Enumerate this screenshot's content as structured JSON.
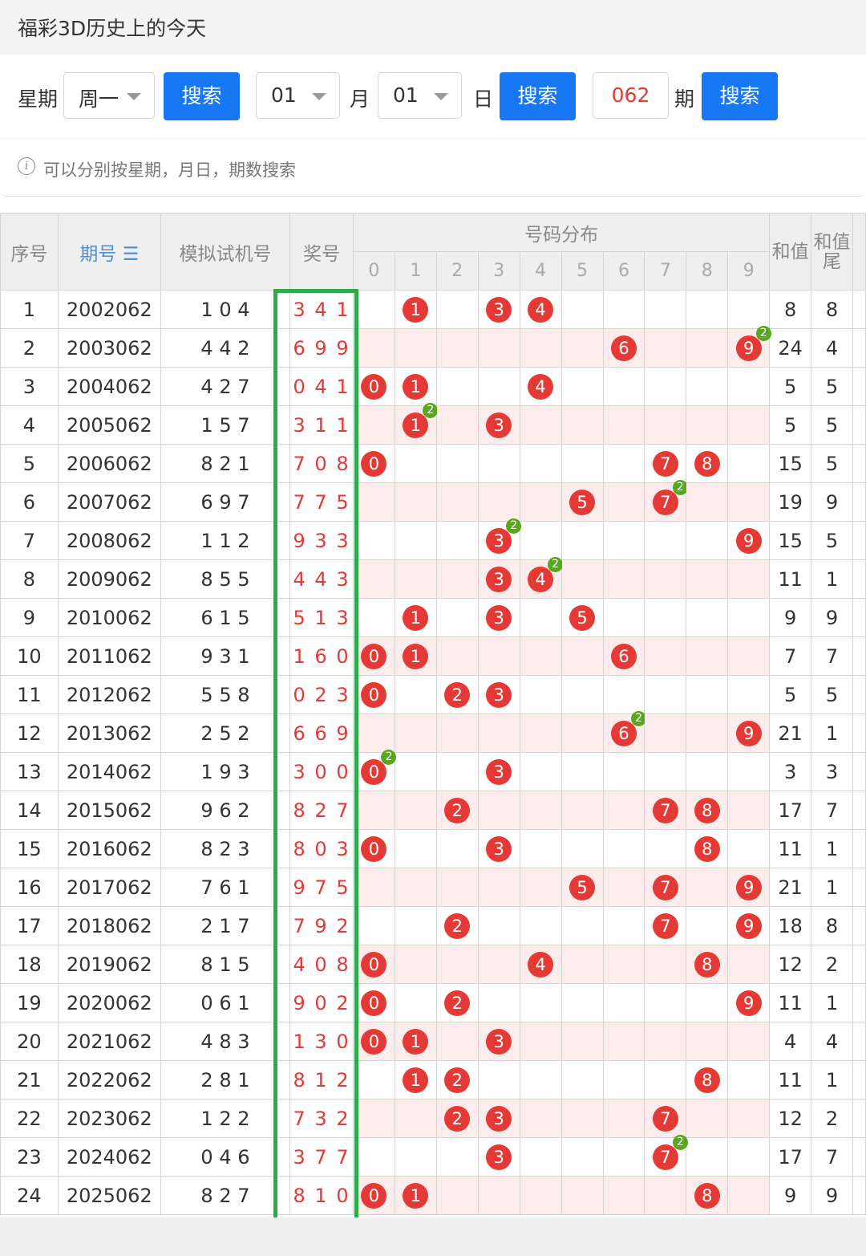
{
  "panel": {
    "title": "福彩3D历史上的今天"
  },
  "search": {
    "week_label": "星期",
    "week_value": "周一",
    "search_label": "搜索",
    "month_value": "01",
    "month_label": "月",
    "day_value": "01",
    "day_label": "日",
    "period_value": "062",
    "period_label": "期"
  },
  "hint": {
    "icon": "i",
    "text": "可以分别按星期，月日，期数搜索"
  },
  "table": {
    "headers": {
      "idx": "序号",
      "period": "期号",
      "sort_icon": "☰",
      "sim": "模拟试机号",
      "prize": "奖号",
      "dist": "号码分布",
      "sum": "和值",
      "tail": "和值尾"
    },
    "digits": [
      "0",
      "1",
      "2",
      "3",
      "4",
      "5",
      "6",
      "7",
      "8",
      "9"
    ],
    "rows": [
      {
        "idx": "1",
        "period": "2002062",
        "sim": "1 0 4",
        "prize": "3 4 1",
        "balls": [
          1,
          3,
          4
        ],
        "rep": null,
        "sum": "8",
        "tail": "8"
      },
      {
        "idx": "2",
        "period": "2003062",
        "sim": "4 4 2",
        "prize": "6 9 9",
        "balls": [
          6,
          9
        ],
        "rep": 9,
        "sum": "24",
        "tail": "4"
      },
      {
        "idx": "3",
        "period": "2004062",
        "sim": "4 2 7",
        "prize": "0 4 1",
        "balls": [
          0,
          1,
          4
        ],
        "rep": null,
        "sum": "5",
        "tail": "5"
      },
      {
        "idx": "4",
        "period": "2005062",
        "sim": "1 5 7",
        "prize": "3 1 1",
        "balls": [
          1,
          3
        ],
        "rep": 1,
        "sum": "5",
        "tail": "5"
      },
      {
        "idx": "5",
        "period": "2006062",
        "sim": "8 2 1",
        "prize": "7 0 8",
        "balls": [
          0,
          7,
          8
        ],
        "rep": null,
        "sum": "15",
        "tail": "5"
      },
      {
        "idx": "6",
        "period": "2007062",
        "sim": "6 9 7",
        "prize": "7 7 5",
        "balls": [
          5,
          7
        ],
        "rep": 7,
        "sum": "19",
        "tail": "9"
      },
      {
        "idx": "7",
        "period": "2008062",
        "sim": "1 1 2",
        "prize": "9 3 3",
        "balls": [
          3,
          9
        ],
        "rep": 3,
        "sum": "15",
        "tail": "5"
      },
      {
        "idx": "8",
        "period": "2009062",
        "sim": "8 5 5",
        "prize": "4 4 3",
        "balls": [
          3,
          4
        ],
        "rep": 4,
        "sum": "11",
        "tail": "1"
      },
      {
        "idx": "9",
        "period": "2010062",
        "sim": "6 1 5",
        "prize": "5 1 3",
        "balls": [
          1,
          3,
          5
        ],
        "rep": null,
        "sum": "9",
        "tail": "9"
      },
      {
        "idx": "10",
        "period": "2011062",
        "sim": "9 3 1",
        "prize": "1 6 0",
        "balls": [
          0,
          1,
          6
        ],
        "rep": null,
        "sum": "7",
        "tail": "7"
      },
      {
        "idx": "11",
        "period": "2012062",
        "sim": "5 5 8",
        "prize": "0 2 3",
        "balls": [
          0,
          2,
          3
        ],
        "rep": null,
        "sum": "5",
        "tail": "5"
      },
      {
        "idx": "12",
        "period": "2013062",
        "sim": "2 5 2",
        "prize": "6 6 9",
        "balls": [
          6,
          9
        ],
        "rep": 6,
        "sum": "21",
        "tail": "1"
      },
      {
        "idx": "13",
        "period": "2014062",
        "sim": "1 9 3",
        "prize": "3 0 0",
        "balls": [
          0,
          3
        ],
        "rep": 0,
        "sum": "3",
        "tail": "3"
      },
      {
        "idx": "14",
        "period": "2015062",
        "sim": "9 6 2",
        "prize": "8 2 7",
        "balls": [
          2,
          7,
          8
        ],
        "rep": null,
        "sum": "17",
        "tail": "7"
      },
      {
        "idx": "15",
        "period": "2016062",
        "sim": "8 2 3",
        "prize": "8 0 3",
        "balls": [
          0,
          3,
          8
        ],
        "rep": null,
        "sum": "11",
        "tail": "1"
      },
      {
        "idx": "16",
        "period": "2017062",
        "sim": "7 6 1",
        "prize": "9 7 5",
        "balls": [
          5,
          7,
          9
        ],
        "rep": null,
        "sum": "21",
        "tail": "1"
      },
      {
        "idx": "17",
        "period": "2018062",
        "sim": "2 1 7",
        "prize": "7 9 2",
        "balls": [
          2,
          7,
          9
        ],
        "rep": null,
        "sum": "18",
        "tail": "8"
      },
      {
        "idx": "18",
        "period": "2019062",
        "sim": "8 1 5",
        "prize": "4 0 8",
        "balls": [
          0,
          4,
          8
        ],
        "rep": null,
        "sum": "12",
        "tail": "2"
      },
      {
        "idx": "19",
        "period": "2020062",
        "sim": "0 6 1",
        "prize": "9 0 2",
        "balls": [
          0,
          2,
          9
        ],
        "rep": null,
        "sum": "11",
        "tail": "1"
      },
      {
        "idx": "20",
        "period": "2021062",
        "sim": "4 8 3",
        "prize": "1 3 0",
        "balls": [
          0,
          1,
          3
        ],
        "rep": null,
        "sum": "4",
        "tail": "4"
      },
      {
        "idx": "21",
        "period": "2022062",
        "sim": "2 8 1",
        "prize": "8 1 2",
        "balls": [
          1,
          2,
          8
        ],
        "rep": null,
        "sum": "11",
        "tail": "1"
      },
      {
        "idx": "22",
        "period": "2023062",
        "sim": "1 2 2",
        "prize": "7 3 2",
        "balls": [
          2,
          3,
          7
        ],
        "rep": null,
        "sum": "12",
        "tail": "2"
      },
      {
        "idx": "23",
        "period": "2024062",
        "sim": "0 4 6",
        "prize": "3 7 7",
        "balls": [
          3,
          7
        ],
        "rep": 7,
        "sum": "17",
        "tail": "7"
      },
      {
        "idx": "24",
        "period": "2025062",
        "sim": "8 2 7",
        "prize": "8 1 0",
        "balls": [
          0,
          1,
          8
        ],
        "rep": null,
        "sum": "9",
        "tail": "9"
      }
    ],
    "rep_label": "2"
  },
  "colors": {
    "accent": "#1877f2",
    "ball": "#e53935",
    "repeat": "#5aa620",
    "highlight": "#2eaa4a"
  }
}
